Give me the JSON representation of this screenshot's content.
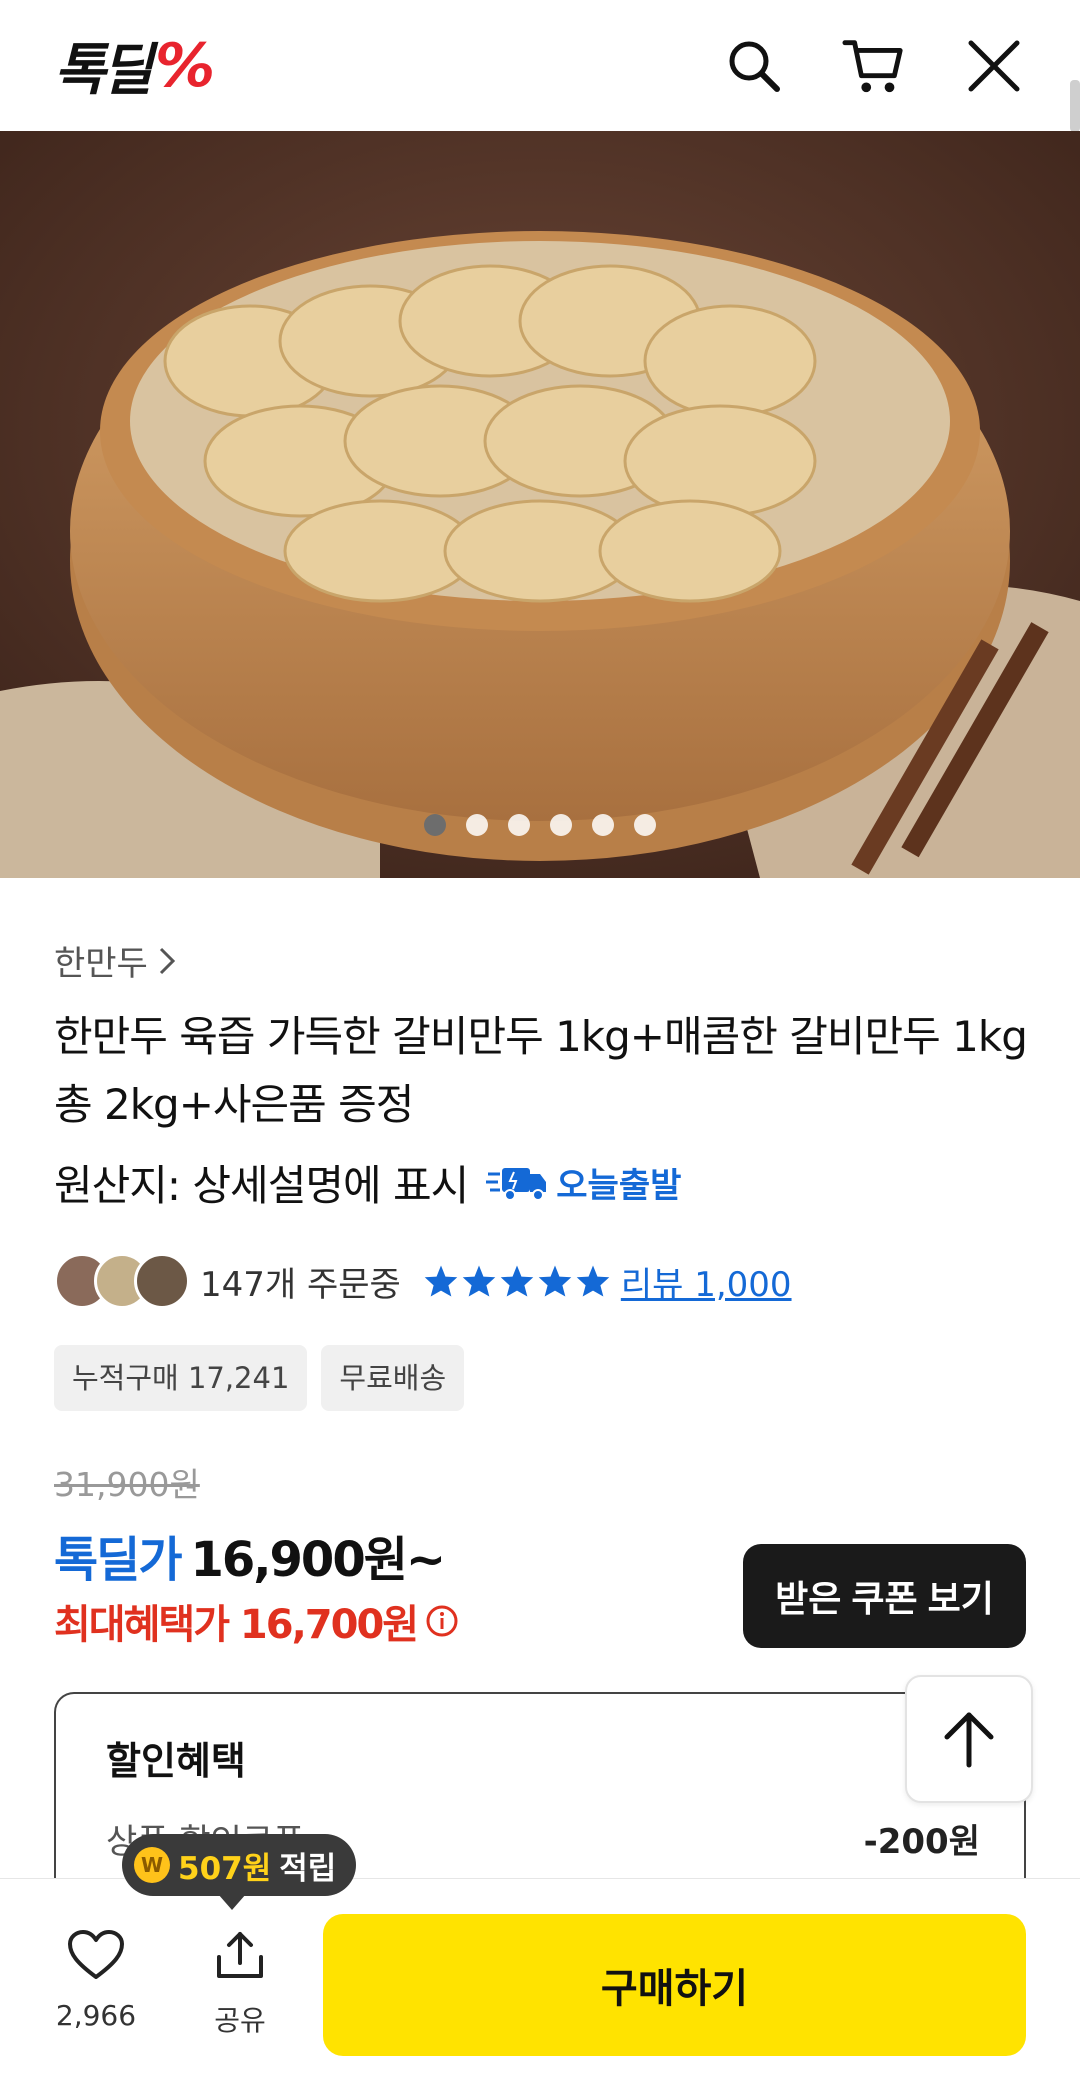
{
  "header": {
    "logo_text": "톡딜",
    "logo_mark": "%"
  },
  "hero": {
    "slide_count": 6,
    "active_index": 0
  },
  "product": {
    "brand": "한만두",
    "title": "한만두 육즙 가득한 갈비만두 1kg+매콤한 갈비만두 1kg 총 2kg+사은품 증정",
    "origin": "원산지: 상세설명에 표시",
    "today_badge": "오늘출발",
    "orders": "147개 주문중",
    "rating_stars": 5,
    "review_link": "리뷰 1,000",
    "chips": [
      "누적구매 17,241",
      "무료배송"
    ]
  },
  "price": {
    "original": "31,900원",
    "sale_label": "톡딜가",
    "sale_price": "16,900원~",
    "max_benefit": "최대혜택가 16,700원",
    "coupon_button": "받은 쿠폰 보기"
  },
  "discount": {
    "title": "할인혜택",
    "item_label": "상품 할인쿠폰",
    "item_value": "-200원"
  },
  "reward": {
    "coin": "W",
    "amount": "507원",
    "text": "적립"
  },
  "bottom": {
    "likes": "2,966",
    "share_label": "공유",
    "buy_button": "구매하기"
  },
  "colors": {
    "accent_blue": "#1469d6",
    "accent_red": "#e0311f",
    "buy_yellow": "#ffe300"
  }
}
